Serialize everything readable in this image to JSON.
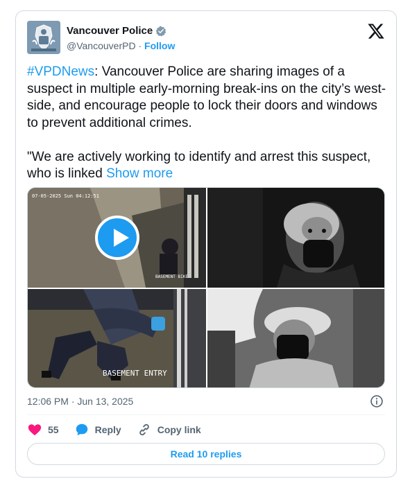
{
  "author": {
    "name": "Vancouver Police",
    "handle": "@VancouverPD",
    "separator": "·",
    "follow_label": "Follow",
    "verified_color": "#829aab"
  },
  "tweet": {
    "hashtag": "#VPDNews",
    "text_part1": ": Vancouver Police are sharing images of a suspect in multiple early-morning break-ins on the city’s west-side, and encourage people to lock their doors and windows to prevent additional crimes.\n\n\"We are actively working to identify and arrest this suspect, who is linked ",
    "show_more": "Show more"
  },
  "media": {
    "cells": [
      {
        "caption_top": "07-05-2025 Sun 04:12:51",
        "caption_bottom": "BASEMENT BIKE",
        "has_play": true
      },
      {
        "caption_top": ""
      },
      {
        "caption_top": ""
      },
      {
        "caption_top": ""
      }
    ],
    "overlay_text": "BASEMENT ENTRY"
  },
  "meta": {
    "timestamp": "12:06 PM · Jun 13, 2025"
  },
  "actions": {
    "likes": "55",
    "reply_label": "Reply",
    "copy_label": "Copy link"
  },
  "read_replies": "Read 10 replies",
  "colors": {
    "accent": "#1d9bf0",
    "like": "#f91880",
    "muted": "#536471"
  }
}
